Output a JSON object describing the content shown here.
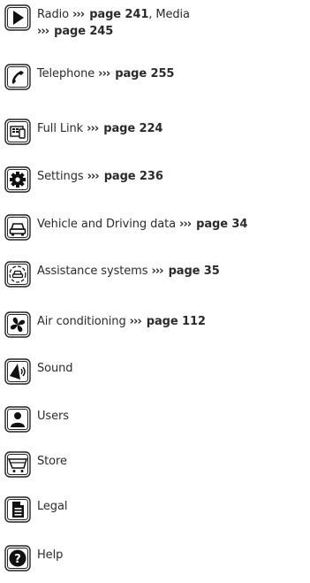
{
  "items": [
    {
      "icon": "play-icon",
      "label": "Radio",
      "ref_prefix": "›››",
      "ref": "page 241",
      "label2": ", Media",
      "ref2_prefix": "›››",
      "ref2": "page 245"
    },
    {
      "icon": "phone-icon",
      "label": "Telephone",
      "ref_prefix": "›››",
      "ref": "page 255"
    },
    {
      "icon": "full-link-icon",
      "label": "Full Link",
      "ref_prefix": "›››",
      "ref": "page 224"
    },
    {
      "icon": "gear-icon",
      "label": "Settings",
      "ref_prefix": "›››",
      "ref": "page 236"
    },
    {
      "icon": "car-icon",
      "label": "Vehicle and Driving data",
      "ref_prefix": "›››",
      "ref": "page 34"
    },
    {
      "icon": "assistance-car-icon",
      "label": "Assistance systems",
      "ref_prefix": "›››",
      "ref": "page 35"
    },
    {
      "icon": "fan-icon",
      "label": "Air conditioning",
      "ref_prefix": "›››",
      "ref": "page 112"
    },
    {
      "icon": "speaker-icon",
      "label": "Sound"
    },
    {
      "icon": "user-icon",
      "label": "Users"
    },
    {
      "icon": "cart-icon",
      "label": "Store"
    },
    {
      "icon": "document-icon",
      "label": "Legal"
    },
    {
      "icon": "help-icon",
      "label": "Help"
    }
  ]
}
